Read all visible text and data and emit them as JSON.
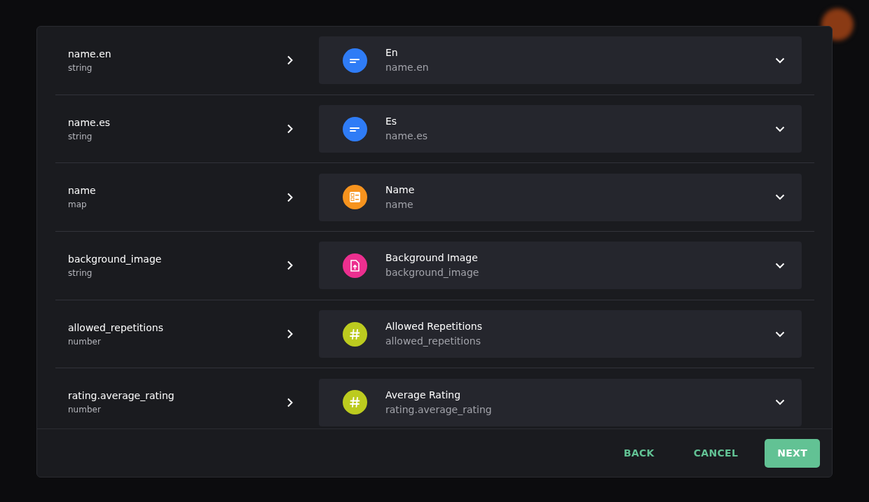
{
  "mappings": [
    {
      "source_name": "name.en",
      "source_type": "string",
      "target_label": "En",
      "target_key": "name.en",
      "kind": "text",
      "color": "#2f7cf6"
    },
    {
      "source_name": "name.es",
      "source_type": "string",
      "target_label": "Es",
      "target_key": "name.es",
      "kind": "text",
      "color": "#2f7cf6"
    },
    {
      "source_name": "name",
      "source_type": "map",
      "target_label": "Name",
      "target_key": "name",
      "kind": "map",
      "color": "#f7931e"
    },
    {
      "source_name": "background_image",
      "source_type": "string",
      "target_label": "Background Image",
      "target_key": "background_image",
      "kind": "file",
      "color": "#ec2f8f"
    },
    {
      "source_name": "allowed_repetitions",
      "source_type": "number",
      "target_label": "Allowed Repetitions",
      "target_key": "allowed_repetitions",
      "kind": "number",
      "color": "#bccb1f"
    },
    {
      "source_name": "rating.average_rating",
      "source_type": "number",
      "target_label": "Average Rating",
      "target_key": "rating.average_rating",
      "kind": "number",
      "color": "#bccb1f"
    }
  ],
  "buttons": [
    {
      "label": "BACK",
      "kind": "text"
    },
    {
      "label": "CANCEL",
      "kind": "text"
    },
    {
      "label": "NEXT",
      "kind": "primary"
    }
  ]
}
